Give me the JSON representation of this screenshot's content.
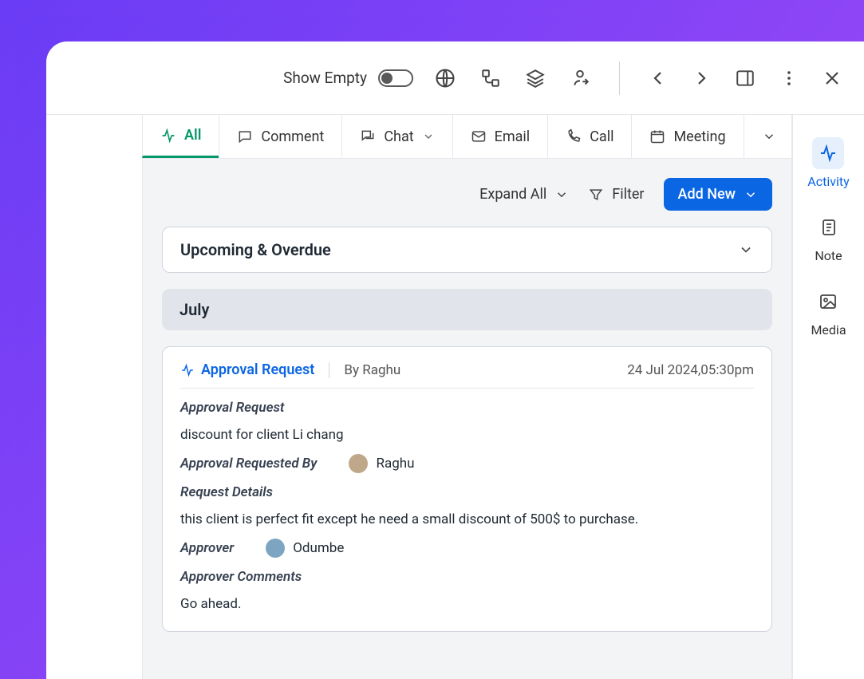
{
  "toolbar": {
    "show_empty_label": "Show Empty",
    "show_empty_value": false
  },
  "tabs": [
    {
      "label": "All",
      "icon": "activity",
      "active": true
    },
    {
      "label": "Comment",
      "icon": "comment"
    },
    {
      "label": "Chat",
      "icon": "chat",
      "dropdown": true
    },
    {
      "label": "Email",
      "icon": "email"
    },
    {
      "label": "Call",
      "icon": "call"
    },
    {
      "label": "Meeting",
      "icon": "meeting"
    }
  ],
  "actions": {
    "expand_all": "Expand All",
    "filter": "Filter",
    "add_new": "Add New"
  },
  "sections": {
    "upcoming_label": "Upcoming & Overdue",
    "month_label": "July"
  },
  "card": {
    "title": "Approval Request",
    "author_prefix": "By",
    "author": "Raghu",
    "timestamp": "24 Jul 2024,05:30pm",
    "fields": {
      "request_label": "Approval Request",
      "request_value": "discount for client Li chang",
      "requested_by_label": "Approval Requested By",
      "requested_by_name": "Raghu",
      "details_label": "Request Details",
      "details_value": "this client is perfect fit except he need a small discount of 500$ to purchase.",
      "approver_label": "Approver",
      "approver_name": "Odumbe",
      "comments_label": "Approver Comments",
      "comments_value": "Go ahead."
    }
  },
  "rail": [
    {
      "label": "Activity",
      "active": true
    },
    {
      "label": "Note"
    },
    {
      "label": "Media"
    }
  ]
}
